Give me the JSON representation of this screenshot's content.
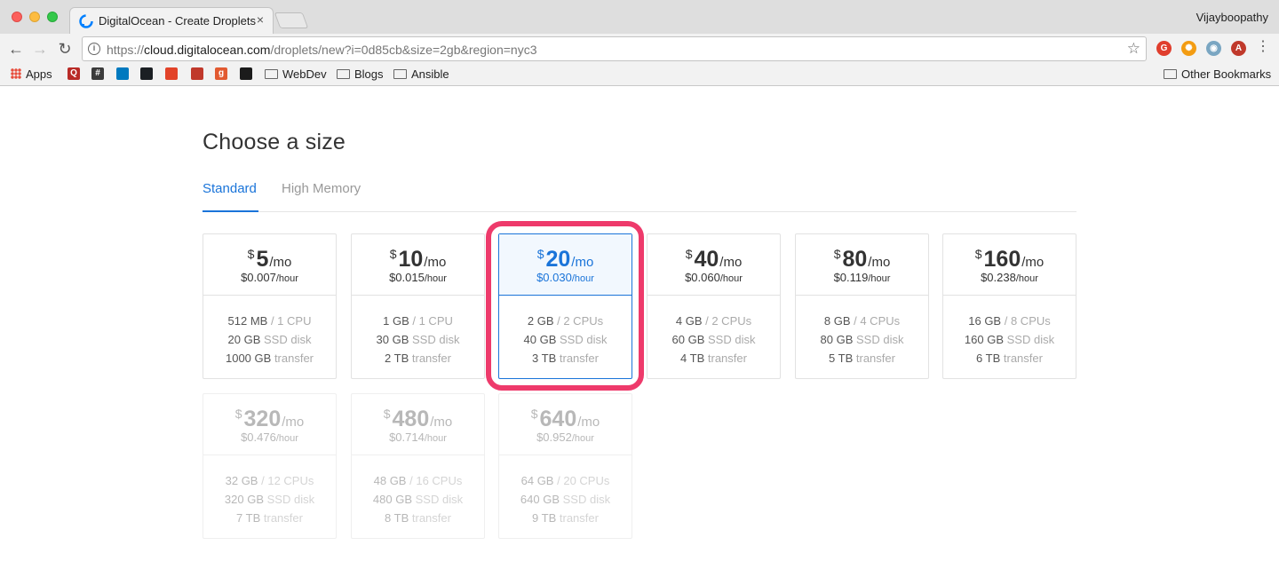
{
  "browser": {
    "tab_title": "DigitalOcean - Create Droplets",
    "tab_close": "×",
    "profile_name": "Vijayboopathy",
    "url_scheme": "https://",
    "url_host": "cloud.digitalocean.com",
    "url_path": "/droplets/new?i=0d85cb&size=2gb&region=nyc3",
    "bookmarks": [
      {
        "label": "Apps",
        "icon": "apps-grid-icon"
      },
      {
        "label": "",
        "icon": "quora-icon",
        "glyph": "Q",
        "color": "#b92b27"
      },
      {
        "label": "",
        "icon": "hashtag-icon",
        "glyph": "#",
        "color": "#3b3b3b"
      },
      {
        "label": "",
        "icon": "trello-icon",
        "glyph": "",
        "color": "#0079bf"
      },
      {
        "label": "",
        "icon": "github-icon",
        "glyph": "",
        "color": "#1b1f23"
      },
      {
        "label": "",
        "icon": "gitlab-icon",
        "glyph": "",
        "color": "#e24329"
      },
      {
        "label": "",
        "icon": "red-square-icon",
        "glyph": "",
        "color": "#c0392b"
      },
      {
        "label": "",
        "icon": "g-icon",
        "glyph": "g",
        "color": "#e25a31"
      },
      {
        "label": "",
        "icon": "spotify-icon",
        "glyph": "",
        "color": "#1b1b1b"
      },
      {
        "label": "WebDev",
        "icon": "folder-icon"
      },
      {
        "label": "Blogs",
        "icon": "folder-icon"
      },
      {
        "label": "Ansible",
        "icon": "folder-icon"
      }
    ],
    "other_bookmarks": "Other Bookmarks"
  },
  "page": {
    "title": "Choose a size",
    "tabs": [
      {
        "label": "Standard",
        "active": true
      },
      {
        "label": "High Memory",
        "active": false
      }
    ]
  },
  "sizes": [
    {
      "currency": "$",
      "amount": "5",
      "per": "/mo",
      "hourly": "$0.007",
      "hourly_unit": "/hour",
      "ram": "512 MB",
      "cpu": "/ 1 CPU",
      "disk": "20 GB",
      "disk_label": "SSD disk",
      "transfer": "1000 GB",
      "transfer_label": "transfer",
      "state": "normal"
    },
    {
      "currency": "$",
      "amount": "10",
      "per": "/mo",
      "hourly": "$0.015",
      "hourly_unit": "/hour",
      "ram": "1 GB",
      "cpu": "/ 1 CPU",
      "disk": "30 GB",
      "disk_label": "SSD disk",
      "transfer": "2 TB",
      "transfer_label": "transfer",
      "state": "normal"
    },
    {
      "currency": "$",
      "amount": "20",
      "per": "/mo",
      "hourly": "$0.030",
      "hourly_unit": "/hour",
      "ram": "2 GB",
      "cpu": "/ 2 CPUs",
      "disk": "40 GB",
      "disk_label": "SSD disk",
      "transfer": "3 TB",
      "transfer_label": "transfer",
      "state": "selected"
    },
    {
      "currency": "$",
      "amount": "40",
      "per": "/mo",
      "hourly": "$0.060",
      "hourly_unit": "/hour",
      "ram": "4 GB",
      "cpu": "/ 2 CPUs",
      "disk": "60 GB",
      "disk_label": "SSD disk",
      "transfer": "4 TB",
      "transfer_label": "transfer",
      "state": "normal"
    },
    {
      "currency": "$",
      "amount": "80",
      "per": "/mo",
      "hourly": "$0.119",
      "hourly_unit": "/hour",
      "ram": "8 GB",
      "cpu": "/ 4 CPUs",
      "disk": "80 GB",
      "disk_label": "SSD disk",
      "transfer": "5 TB",
      "transfer_label": "transfer",
      "state": "normal"
    },
    {
      "currency": "$",
      "amount": "160",
      "per": "/mo",
      "hourly": "$0.238",
      "hourly_unit": "/hour",
      "ram": "16 GB",
      "cpu": "/ 8 CPUs",
      "disk": "160 GB",
      "disk_label": "SSD disk",
      "transfer": "6 TB",
      "transfer_label": "transfer",
      "state": "normal"
    },
    {
      "currency": "$",
      "amount": "320",
      "per": "/mo",
      "hourly": "$0.476",
      "hourly_unit": "/hour",
      "ram": "32 GB",
      "cpu": "/ 12 CPUs",
      "disk": "320 GB",
      "disk_label": "SSD disk",
      "transfer": "7 TB",
      "transfer_label": "transfer",
      "state": "disabled"
    },
    {
      "currency": "$",
      "amount": "480",
      "per": "/mo",
      "hourly": "$0.714",
      "hourly_unit": "/hour",
      "ram": "48 GB",
      "cpu": "/ 16 CPUs",
      "disk": "480 GB",
      "disk_label": "SSD disk",
      "transfer": "8 TB",
      "transfer_label": "transfer",
      "state": "disabled"
    },
    {
      "currency": "$",
      "amount": "640",
      "per": "/mo",
      "hourly": "$0.952",
      "hourly_unit": "/hour",
      "ram": "64 GB",
      "cpu": "/ 20 CPUs",
      "disk": "640 GB",
      "disk_label": "SSD disk",
      "transfer": "9 TB",
      "transfer_label": "transfer",
      "state": "disabled"
    }
  ],
  "colors": {
    "accent": "#1a74d9",
    "highlight": "#ee3a6b"
  }
}
